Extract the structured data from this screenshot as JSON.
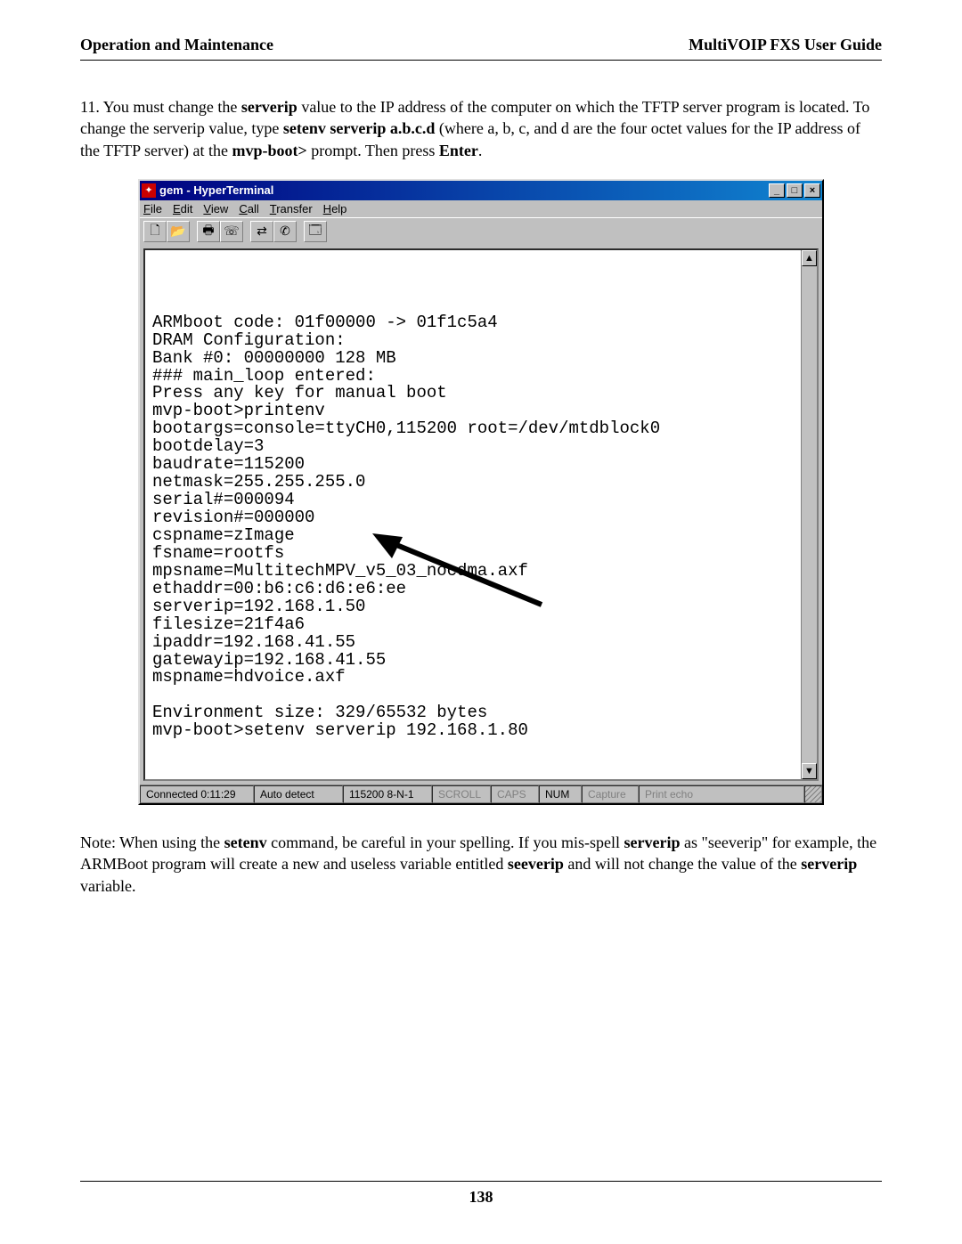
{
  "header": {
    "left": "Operation and Maintenance",
    "right": "MultiVOIP FXS User Guide"
  },
  "para1": {
    "prefix": "11. You must change the  ",
    "b1": "serverip",
    "t2": "  value to the IP address of the computer on which the TFTP server program is located.  To change the serverip value,  type  ",
    "b2": "setenv serverip a.b.c.d",
    "t3": "   (where a, b, c, and d are the four octet values for the IP address of the TFTP server) at the ",
    "b3": "mvp-boot>",
    "t4": " prompt.  Then press ",
    "b4": "Enter",
    "t5": "."
  },
  "window": {
    "title": "gem - HyperTerminal",
    "menu": [
      "File",
      "Edit",
      "View",
      "Call",
      "Transfer",
      "Help"
    ],
    "toolbar_icons": [
      "new-file-icon",
      "open-file-icon",
      "print-icon",
      "phone-icon",
      "connect-icon",
      "disconnect-icon",
      "properties-icon"
    ]
  },
  "terminal_lines": [
    "ARMboot code: 01f00000 -> 01f1c5a4",
    "DRAM Configuration:",
    "Bank #0: 00000000 128 MB",
    "### main_loop entered:",
    "Press any key for manual boot",
    "mvp-boot>printenv",
    "bootargs=console=ttyCH0,115200 root=/dev/mtdblock0",
    "bootdelay=3",
    "baudrate=115200",
    "netmask=255.255.255.0",
    "serial#=000094",
    "revision#=000000",
    "cspname=zImage",
    "fsname=rootfs",
    "mpsname=MultitechMPV_v5_03_nocdma.axf",
    "ethaddr=00:b6:c6:d6:e6:ee",
    "serverip=192.168.1.50",
    "filesize=21f4a6",
    "ipaddr=192.168.41.55",
    "gatewayip=192.168.41.55",
    "mspname=hdvoice.axf",
    "",
    "Environment size: 329/65532 bytes",
    "mvp-boot>setenv serverip 192.168.1.80"
  ],
  "status": {
    "connected": "Connected 0:11:29",
    "detect": "Auto detect",
    "settings": "115200 8-N-1",
    "scroll": "SCROLL",
    "caps": "CAPS",
    "num": "NUM",
    "capture": "Capture",
    "printecho": "Print echo"
  },
  "note": {
    "t1": "Note: When using the ",
    "b1": "setenv",
    "t2": " command, be careful in your spelling.  If you mis-spell ",
    "b2": "serverip",
    "t3": " as \"seeverip\" for example, the ARMBoot program will create a new and useless variable entitled ",
    "b3": "seeverip",
    "t4": " and will not change the value of the ",
    "b4": "serverip",
    "t5": " variable."
  },
  "page_number": "138"
}
